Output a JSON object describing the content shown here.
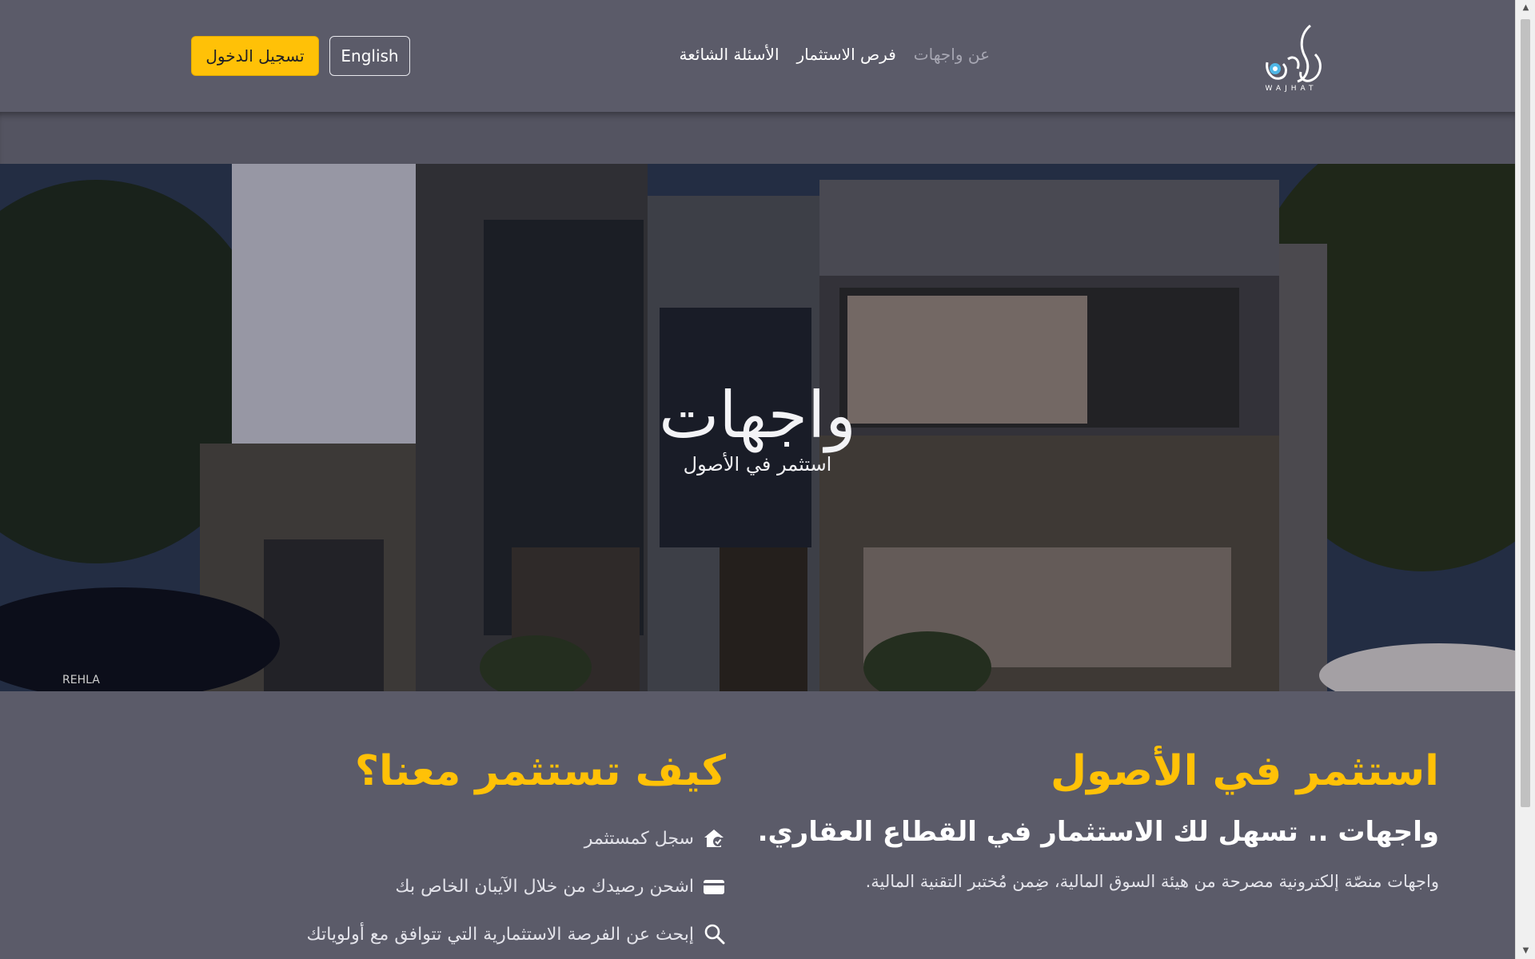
{
  "header": {
    "logo_text": "WAJHAT",
    "nav": [
      {
        "label": "عن واجهات"
      },
      {
        "label": "فرص الاستثمار"
      },
      {
        "label": "الأسئلة الشائعة"
      }
    ],
    "lang_button": "English",
    "login_button": "تسجيل الدخول"
  },
  "hero": {
    "title": "واجهات",
    "subtitle": "استثمر في الأصول",
    "watermark": "REHLA"
  },
  "about": {
    "heading": "استثمر في الأصول",
    "subheading": "واجهات .. تسهل لك الاستثمار في القطاع العقاري.",
    "text": "واجهات منصّة إلكترونية مصرحة من هيئة السوق المالية، ضِمن مُختبر التقنية المالية."
  },
  "how": {
    "heading": "كيف تستثمر معنا؟",
    "steps": [
      {
        "icon": "house-check-icon",
        "label": "سجل كمستثمر"
      },
      {
        "icon": "wallet-icon",
        "label": "اشحن رصيدك من خلال الآيبان الخاص بك"
      },
      {
        "icon": "search-icon",
        "label": "إبحث عن الفرصة الاستثمارية التي تتوافق مع أولوياتك"
      }
    ]
  },
  "colors": {
    "accent": "#ffc107",
    "background": "#5b5b69"
  }
}
